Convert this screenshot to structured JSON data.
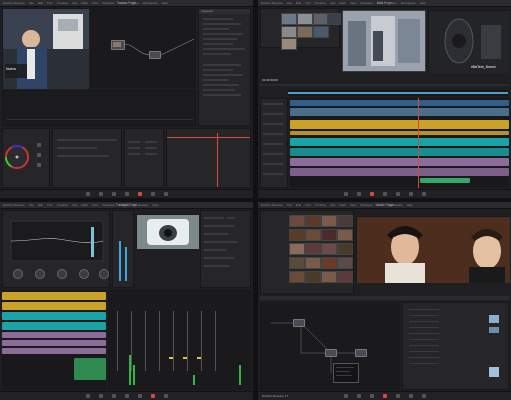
{
  "q1": {
    "title": "Fusion Page",
    "menus": [
      "DaVinci Resolve",
      "File",
      "Edit",
      "Trim",
      "Timeline",
      "Clip",
      "Mark",
      "View",
      "Playback",
      "Fusion",
      "Color",
      "Workspace",
      "Help"
    ],
    "overlay_text": "Nueva",
    "inspector_title": "Inspector"
  },
  "q2": {
    "title": "Edit Page",
    "menus": [
      "DaVinci Resolve",
      "File",
      "Edit",
      "Trim",
      "Timeline",
      "Clip",
      "Mark",
      "View",
      "Playback",
      "Fusion",
      "Color",
      "Workspace",
      "Help"
    ],
    "timecode": "01:00:00:00",
    "watermark": "#BizTech_Brunch"
  },
  "q3": {
    "title": "Fairlight Page",
    "menus": [
      "DaVinci Resolve",
      "File",
      "Edit",
      "Trim",
      "Timeline",
      "Clip",
      "Mark",
      "View",
      "Playback",
      "Fairlight",
      "Workspace",
      "Help"
    ]
  },
  "q4": {
    "title": "Media Page",
    "menus": [
      "DaVinci Resolve",
      "File",
      "Edit",
      "Trim",
      "Timeline",
      "Clip",
      "Mark",
      "View",
      "Playback",
      "Color",
      "Workspace",
      "Help"
    ],
    "logo_text": "DaVinci Resolve 17"
  },
  "colors": {
    "accent_red": "#d34b39",
    "track_yellow": "#c9a227",
    "track_teal": "#1aa3a6",
    "track_purple": "#8c6d9a",
    "meter_green": "#2fb84a"
  }
}
